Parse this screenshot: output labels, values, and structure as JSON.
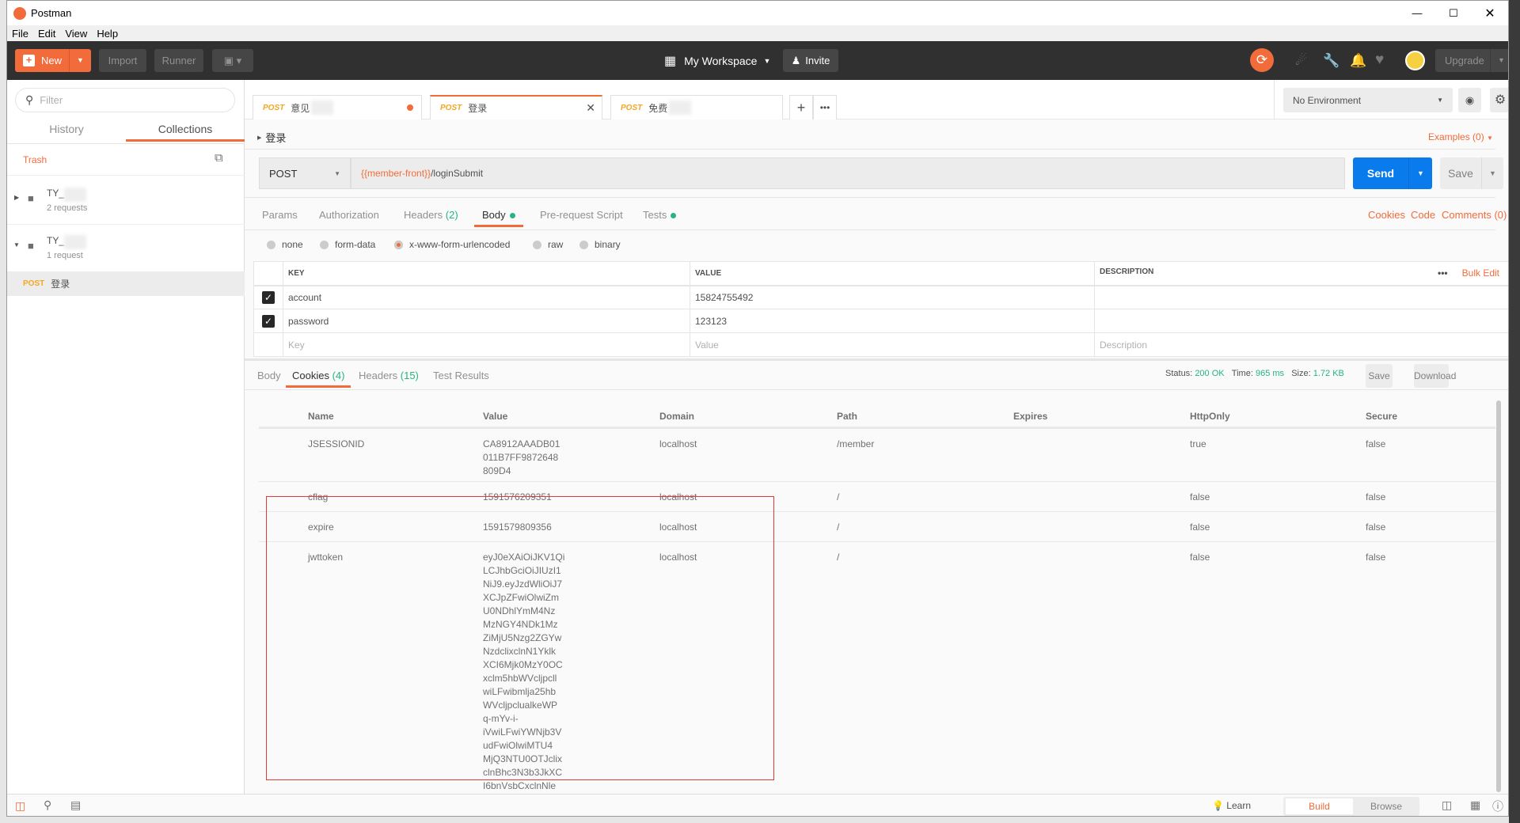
{
  "app": {
    "title": "Postman",
    "menu": [
      "File",
      "Edit",
      "View",
      "Help"
    ]
  },
  "header": {
    "new_label": "New",
    "import_label": "Import",
    "runner_label": "Runner",
    "workspace": "My Workspace",
    "invite": "Invite",
    "upgrade": "Upgrade",
    "accent": "#f26b3a"
  },
  "sidebar": {
    "filter_placeholder": "Filter",
    "tabs": [
      "History",
      "Collections"
    ],
    "active_tab": "Collections",
    "trash": "Trash",
    "collections": [
      {
        "name": "TY_",
        "count": "2 requests",
        "expanded": false
      },
      {
        "name": "TY_",
        "count": "1 request",
        "expanded": true
      }
    ],
    "requests": [
      {
        "method": "POST",
        "name": "登录"
      }
    ]
  },
  "tabs": [
    {
      "method": "POST",
      "name": "意见",
      "unsaved": true
    },
    {
      "method": "POST",
      "name": "登录",
      "active": true
    },
    {
      "method": "POST",
      "name": "免费"
    }
  ],
  "environment": {
    "selected": "No Environment"
  },
  "request": {
    "name": "登录",
    "examples": "Examples (0)",
    "method": "POST",
    "url_var": "{{member-front}}",
    "url_path": "/loginSubmit",
    "send": "Send",
    "save": "Save",
    "tabs": [
      "Params",
      "Authorization",
      "Headers",
      "(2)",
      "Body",
      "Pre-request Script",
      "Tests"
    ],
    "active_tab": "Body",
    "links": [
      "Cookies",
      "Code",
      "Comments (0)"
    ],
    "body_modes": [
      "none",
      "form-data",
      "x-www-form-urlencoded",
      "raw",
      "binary"
    ],
    "selected_mode": "x-www-form-urlencoded",
    "columns": [
      "KEY",
      "VALUE",
      "DESCRIPTION"
    ],
    "bulk_edit": "Bulk Edit",
    "params": [
      {
        "checked": true,
        "key": "account",
        "value": "15824755492",
        "description": ""
      },
      {
        "checked": true,
        "key": "password",
        "value": "123123",
        "description": ""
      }
    ],
    "placeholders": {
      "key": "Key",
      "value": "Value",
      "description": "Description"
    }
  },
  "response": {
    "tabs": [
      "Body",
      "Cookies",
      "(4)",
      "Headers",
      "(15)",
      "Test Results"
    ],
    "active_tab": "Cookies",
    "status_label": "Status:",
    "status": "200 OK",
    "time_label": "Time:",
    "time": "965 ms",
    "size_label": "Size:",
    "size": "1.72 KB",
    "save": "Save",
    "download": "Download",
    "cookie_columns": [
      "Name",
      "Value",
      "Domain",
      "Path",
      "Expires",
      "HttpOnly",
      "Secure"
    ],
    "cookies": [
      {
        "name": "JSESSIONID",
        "value": [
          "CA8912AAADB01",
          "011B7FF9872648",
          "809D4"
        ],
        "domain": "localhost",
        "path": "/member",
        "expires": "",
        "httponly": "true",
        "secure": "false"
      },
      {
        "name": "cflag",
        "value": [
          "1591576209351"
        ],
        "domain": "localhost",
        "path": "/",
        "expires": "",
        "httponly": "false",
        "secure": "false"
      },
      {
        "name": "expire",
        "value": [
          "1591579809356"
        ],
        "domain": "localhost",
        "path": "/",
        "expires": "",
        "httponly": "false",
        "secure": "false"
      },
      {
        "name": "jwttoken",
        "value": [
          "eyJ0eXAiOiJKV1Qi",
          "LCJhbGciOiJIUzI1",
          "NiJ9.eyJzdWliOiJ7",
          "XCJpZFwiOlwiZm",
          "U0NDhlYmM4Nz",
          "MzNGY4NDk1Mz",
          "ZiMjU5Nzg2ZGYw",
          "NzdclixclnN1Yklk",
          "XCI6Mjk0MzY0OC",
          "xclm5hbWVcljpcll",
          "wiLFwibmlja25hb",
          "WVcljpclualkeWP",
          "q-mYv-i-",
          "iVwiLFwiYWNjb3V",
          "udFwiOlwiMTU4",
          "MjQ3NTU0OTJclix",
          "clnBhc3N3b3JkXC",
          "I6bnVsbCxclnNle"
        ],
        "domain": "localhost",
        "path": "/",
        "expires": "",
        "httponly": "false",
        "secure": "false"
      }
    ]
  },
  "annotation": {
    "color": "#e53935"
  },
  "statusbar": {
    "learn": "Learn",
    "build": "Build",
    "browse": "Browse"
  }
}
